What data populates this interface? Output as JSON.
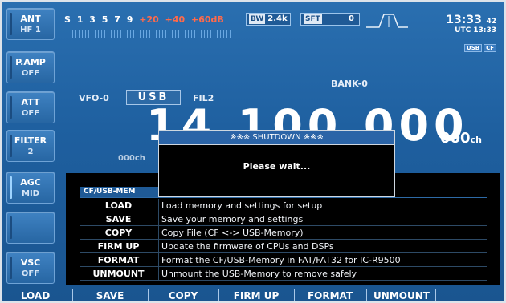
{
  "left_keys": [
    {
      "title": "ANT",
      "value": "HF 1"
    },
    {
      "title": "P.AMP",
      "value": "OFF"
    },
    {
      "title": "ATT",
      "value": "OFF"
    },
    {
      "title": "FILTER",
      "value": "2"
    },
    {
      "title": "AGC",
      "value": "MID"
    },
    {
      "title": "",
      "value": ""
    },
    {
      "title": "VSC",
      "value": "OFF"
    }
  ],
  "meter": {
    "s_label": "S",
    "scale_white": [
      "1",
      "3",
      "5",
      "7",
      "9"
    ],
    "scale_red": [
      "+20",
      "+40",
      "+60dB"
    ]
  },
  "bw": {
    "label": "BW",
    "value": "2.4k"
  },
  "sft": {
    "label": "SFT",
    "value": "0"
  },
  "clock": {
    "time": "13:33",
    "seconds": "42",
    "utc": "UTC 13:33",
    "tags": [
      "USB",
      "CF"
    ]
  },
  "vfo": {
    "label": "VFO-0",
    "mode": "USB",
    "filter": "FIL2",
    "bank": "BANK-0",
    "sub_ch": "000ch",
    "frequency": "14.100.000",
    "memory_ch": "000",
    "ch_suffix": "ch"
  },
  "dialog": {
    "title": "※※※ SHUTDOWN ※※※",
    "message": "Please wait..."
  },
  "panel": {
    "tab": "CF/USB-MEM",
    "rows": [
      {
        "name": "LOAD",
        "desc": "Load memory and settings for setup"
      },
      {
        "name": "SAVE",
        "desc": "Save your memory and settings"
      },
      {
        "name": "COPY",
        "desc": "Copy File (CF <-> USB-Memory)"
      },
      {
        "name": "FIRM UP",
        "desc": "Update the firmware of CPUs and DSPs"
      },
      {
        "name": "FORMAT",
        "desc": "Format the CF/USB-Memory in FAT/FAT32 for IC-R9500"
      },
      {
        "name": "UNMOUNT",
        "desc": "Unmount the USB-Memory to remove safely"
      }
    ]
  },
  "fkeys": [
    "LOAD",
    "SAVE",
    "COPY",
    "FIRM UP",
    "FORMAT",
    "UNMOUNT"
  ]
}
